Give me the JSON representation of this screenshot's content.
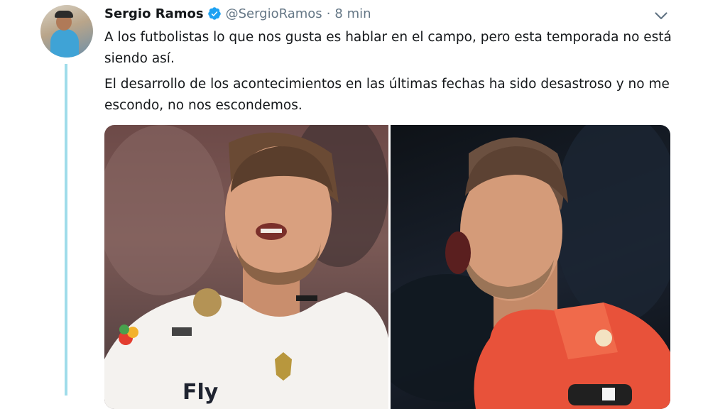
{
  "tweet": {
    "author_name": "Sergio Ramos",
    "handle": "@SergioRamos",
    "separator": "·",
    "time": "8 min",
    "paragraphs": [
      "A los futbolistas lo que nos gusta es hablar en el campo, pero esta temporada no está siendo así.",
      "El desarrollo de los acontecimientos en las últimas fechas ha sido desastroso y no me escondo, no nos escondemos."
    ]
  },
  "media": {
    "shirt_text": "Fly"
  },
  "icons": {
    "verified": "verified-badge-icon",
    "menu": "chevron-down-icon"
  },
  "colors": {
    "verified": "#1da1f2",
    "muted": "#657786",
    "thread_line": "#9fdcea"
  }
}
